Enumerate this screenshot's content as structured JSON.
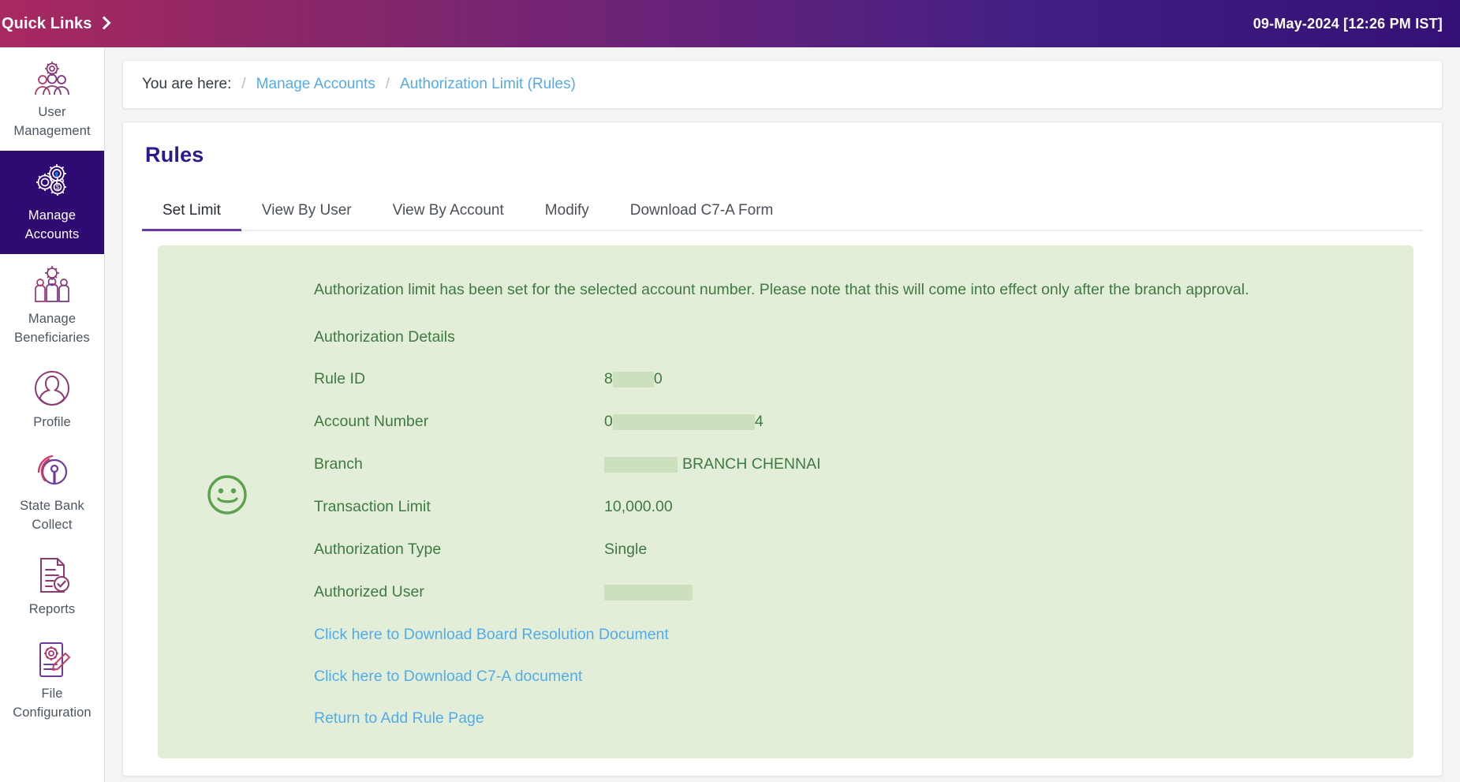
{
  "topbar": {
    "quick_links_label": "Quick Links",
    "datetime": "09-May-2024 [12:26 PM IST]"
  },
  "sidebar": {
    "items": [
      {
        "label": "User Management",
        "icon": "users-gear-icon",
        "active": false
      },
      {
        "label": "Manage Accounts",
        "icon": "gears-accounts-icon",
        "active": true
      },
      {
        "label": "Manage Beneficiaries",
        "icon": "beneficiaries-gear-icon",
        "active": false
      },
      {
        "label": "Profile",
        "icon": "profile-avatar-icon",
        "active": false
      },
      {
        "label": "State Bank Collect",
        "icon": "state-bank-collect-icon",
        "active": false
      },
      {
        "label": "Reports",
        "icon": "document-check-icon",
        "active": false
      },
      {
        "label": "File Configuration",
        "icon": "document-gear-pencil-icon",
        "active": false
      }
    ]
  },
  "breadcrumb": {
    "prefix": "You are here:",
    "separator": "/",
    "items": [
      "Manage Accounts",
      "Authorization Limit (Rules)"
    ]
  },
  "page": {
    "title": "Rules",
    "tabs": [
      {
        "label": "Set Limit",
        "active": true
      },
      {
        "label": "View By User",
        "active": false
      },
      {
        "label": "View By Account",
        "active": false
      },
      {
        "label": "Modify",
        "active": false
      },
      {
        "label": "Download C7-A Form",
        "active": false
      }
    ]
  },
  "success": {
    "icon": "smiley-face-icon",
    "message": "Authorization limit has been set for the selected account number. Please note that this will come into effect only after the branch approval.",
    "section_title": "Authorization Details",
    "details": [
      {
        "label": "Rule ID",
        "prefix": "8",
        "redacted": true,
        "suffix": "0",
        "redact_width": 52
      },
      {
        "label": "Account Number",
        "prefix": "0",
        "redacted": true,
        "suffix": "4",
        "redact_width": 180
      },
      {
        "label": "Branch",
        "prefix": "",
        "redacted": true,
        "suffix": "BRANCH CHENNAI",
        "redact_width": 93
      },
      {
        "label": "Transaction Limit",
        "prefix": "10,000.00",
        "redacted": false,
        "suffix": "",
        "redact_width": 0
      },
      {
        "label": "Authorization Type",
        "prefix": "Single",
        "redacted": false,
        "suffix": "",
        "redact_width": 0
      },
      {
        "label": "Authorized User",
        "prefix": "",
        "redacted": true,
        "suffix": "",
        "redact_width": 112
      }
    ],
    "links": [
      "Click here to Download Board Resolution Document",
      "Click here to Download C7-A document",
      "Return to Add Rule Page"
    ]
  },
  "colors": {
    "topbar_start": "#a92861",
    "topbar_end": "#351075",
    "sidebar_active_bg": "#2e0a72",
    "title_purple": "#2b1a8c",
    "tab_underline": "#6a3ba5",
    "link_blue": "#53abe8",
    "success_bg": "#e3eed9",
    "success_text": "#3e7a41"
  }
}
